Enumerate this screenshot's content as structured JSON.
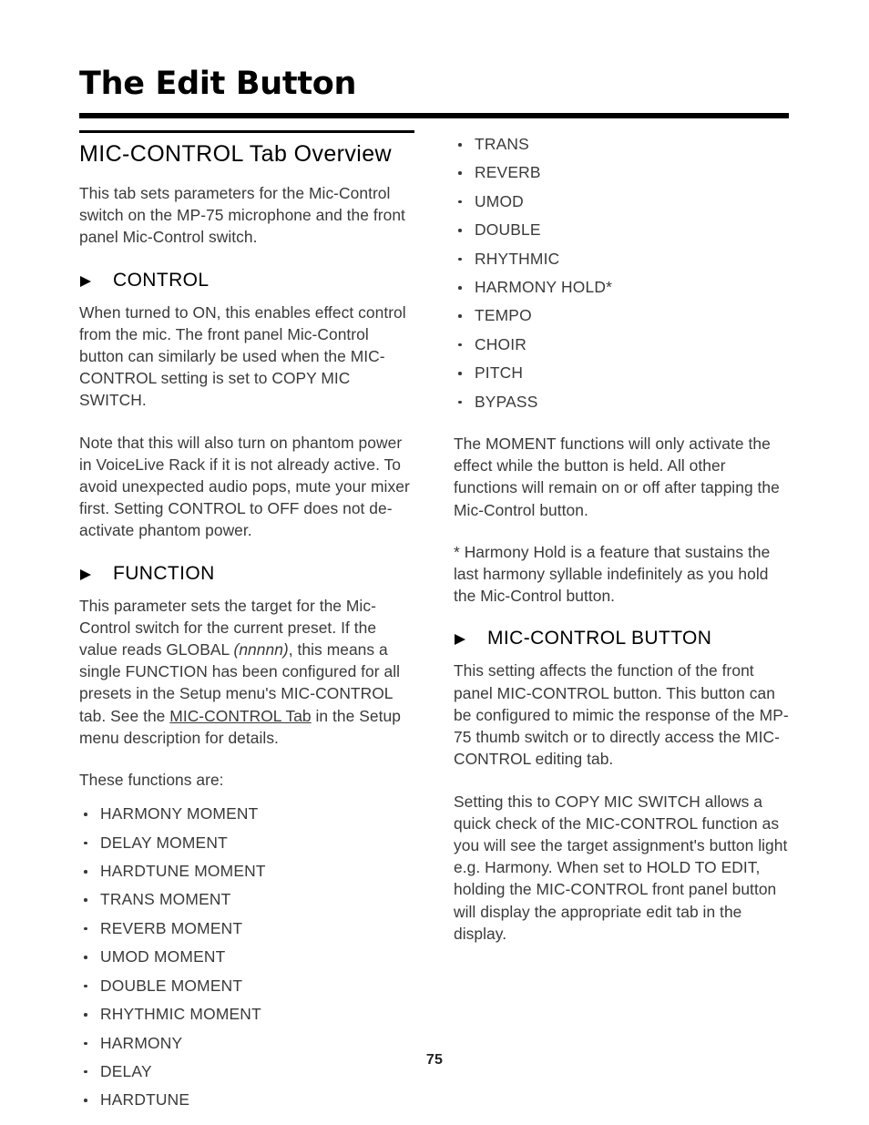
{
  "document": {
    "title": "The Edit Button",
    "page_number": "75"
  },
  "left_column": {
    "section_heading": "MIC-CONTROL Tab Overview",
    "intro_paragraph": "This tab sets parameters for the Mic-Control switch on the MP-75 microphone and the front panel Mic-Control switch.",
    "control": {
      "heading": "CONTROL",
      "paragraph_1": "When turned to ON, this enables effect control from the mic. The front panel Mic-Control button can similarly be used when the MIC-CONTROL setting is set to COPY MIC SWITCH.",
      "paragraph_2": "Note that this will also turn on phantom power in VoiceLive Rack if it is not already active. To avoid unexpected audio  pops, mute your mixer first. Setting CONTROL to OFF does not de-activate phantom power."
    },
    "function": {
      "heading": "FUNCTION",
      "paragraph_parts": {
        "a": "This parameter sets the target for the Mic-Control switch for the current preset. If the value reads GLOBAL ",
        "b_italic": "(nnnnn)",
        "c": ", this means a single FUNCTION has been configured for all presets in the Setup menu's MIC-CONTROL tab. See the ",
        "d_link": "MIC-CONTROL Tab",
        "e": " in the Setup menu description for details."
      },
      "list_intro": "These functions are:",
      "functions_list": [
        "HARMONY MOMENT",
        "DELAY MOMENT",
        "HARDTUNE MOMENT",
        "TRANS MOMENT",
        "REVERB MOMENT",
        "UMOD MOMENT",
        "DOUBLE MOMENT",
        "RHYTHMIC MOMENT",
        "HARMONY",
        "DELAY",
        "HARDTUNE"
      ]
    }
  },
  "right_column": {
    "functions_list_continued": [
      "TRANS",
      "REVERB",
      "UMOD",
      "DOUBLE",
      "RHYTHMIC",
      "HARMONY HOLD*",
      "TEMPO",
      "CHOIR",
      "PITCH",
      "BYPASS"
    ],
    "moment_paragraph": "The MOMENT functions will only activate the effect while the button is held. All other functions will remain on or off after tapping the Mic-Control button.",
    "footnote_paragraph": "* Harmony Hold is a feature that sustains the last harmony syllable indefinitely as you hold the Mic-Control button.",
    "mic_control_button": {
      "heading": "MIC-CONTROL BUTTON",
      "paragraph_1": "This setting affects the function of the front panel MIC-CONTROL button. This button can be configured to mimic the response of the MP-75 thumb switch or to directly access the MIC-CONTROL editing tab.",
      "paragraph_2": "Setting this to COPY MIC SWITCH allows a quick check of the MIC-CONTROL function as you will see the target assignment's button light e.g. Harmony. When set to HOLD TO EDIT, holding the MIC-CONTROL front panel button will display the appropriate edit tab in the display."
    }
  },
  "icons": {
    "section_marker": "triangle-right-icon",
    "bullet": "bullet-dot-icon"
  },
  "colors": {
    "text": "#3a3a3c",
    "heading": "#000000",
    "rule": "#000000",
    "background": "#ffffff"
  }
}
